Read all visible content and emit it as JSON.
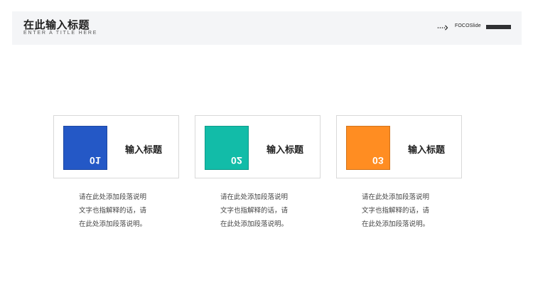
{
  "header": {
    "title": "在此输入标题",
    "subtitle": "ENTER A TITLE HERE",
    "brand": "FOCOSlide"
  },
  "colors": {
    "header_bg": "#f4f5f7",
    "blue": "#2458c6",
    "teal": "#12bca8",
    "orange": "#ff8d22",
    "card_border": "#d9d9d9",
    "text_dark": "#222222",
    "text_body": "#444444"
  },
  "cards": [
    {
      "number": "01",
      "title": "输入标题",
      "description_lines": [
        "请在此处添加段落说明",
        "文字也指解释的话，请",
        "在此处添加段落说明。"
      ]
    },
    {
      "number": "02",
      "title": "输入标题",
      "description_lines": [
        "请在此处添加段落说明",
        "文字也指解释的话，请",
        "在此处添加段落说明。"
      ]
    },
    {
      "number": "03",
      "title": "输入标题",
      "description_lines": [
        "请在此处添加段落说明",
        "文字也指解释的话，请",
        "在此处添加段落说明。"
      ]
    }
  ],
  "icons": {
    "header_arrow": "arrow-right-icon"
  }
}
